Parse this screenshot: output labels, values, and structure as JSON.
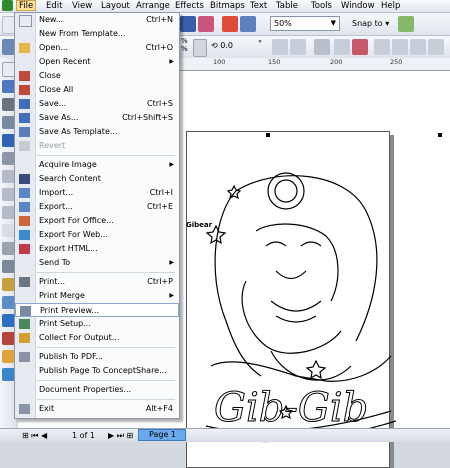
{
  "menubar": {
    "items": [
      "File",
      "Edit",
      "View",
      "Layout",
      "Arrange",
      "Effects",
      "Bitmaps",
      "Text",
      "Table",
      "Tools",
      "Window",
      "Help"
    ]
  },
  "toolbar": {
    "zoom": "50%",
    "snap_label": "Snap to",
    "rotation": "0.0",
    "percent_a": "%",
    "percent_b": "%"
  },
  "ruler": {
    "ticks": [
      "100",
      "150",
      "200",
      "250"
    ]
  },
  "file_menu": {
    "items": [
      {
        "label": "New...",
        "shortcut": "Ctrl+N"
      },
      {
        "label": "New From Template...",
        "shortcut": ""
      },
      {
        "label": "Open...",
        "shortcut": "Ctrl+O"
      },
      {
        "label": "Open Recent",
        "shortcut": ""
      },
      {
        "label": "Close",
        "shortcut": ""
      },
      {
        "label": "Close All",
        "shortcut": ""
      },
      {
        "label": "Save...",
        "shortcut": "Ctrl+S"
      },
      {
        "label": "Save As...",
        "shortcut": "Ctrl+Shift+S"
      },
      {
        "label": "Save As Template...",
        "shortcut": ""
      },
      {
        "label": "Revert",
        "shortcut": ""
      },
      {
        "label": "Acquire Image",
        "shortcut": ""
      },
      {
        "label": "Search Content",
        "shortcut": ""
      },
      {
        "label": "Import...",
        "shortcut": "Ctrl+I"
      },
      {
        "label": "Export...",
        "shortcut": "Ctrl+E"
      },
      {
        "label": "Export For Office...",
        "shortcut": ""
      },
      {
        "label": "Export For Web...",
        "shortcut": ""
      },
      {
        "label": "Export HTML...",
        "shortcut": ""
      },
      {
        "label": "Send To",
        "shortcut": ""
      },
      {
        "label": "Print...",
        "shortcut": "Ctrl+P"
      },
      {
        "label": "Print Merge",
        "shortcut": ""
      },
      {
        "label": "Print Preview...",
        "shortcut": ""
      },
      {
        "label": "Print Setup...",
        "shortcut": ""
      },
      {
        "label": "Collect For Output...",
        "shortcut": ""
      },
      {
        "label": "Publish To PDF...",
        "shortcut": ""
      },
      {
        "label": "Publish Page To ConceptShare...",
        "shortcut": ""
      },
      {
        "label": "Document Properties...",
        "shortcut": ""
      },
      {
        "label": "Exit",
        "shortcut": "Alt+F4"
      }
    ]
  },
  "drawing": {
    "text": "Gib-Gib",
    "signature": "Gibear"
  },
  "statusbar": {
    "page_info": "1 of 1",
    "page_tab": "Page 1"
  },
  "colors": {
    "menu_highlight": "#ffe29a",
    "page_tab": "#6aa9ec"
  }
}
